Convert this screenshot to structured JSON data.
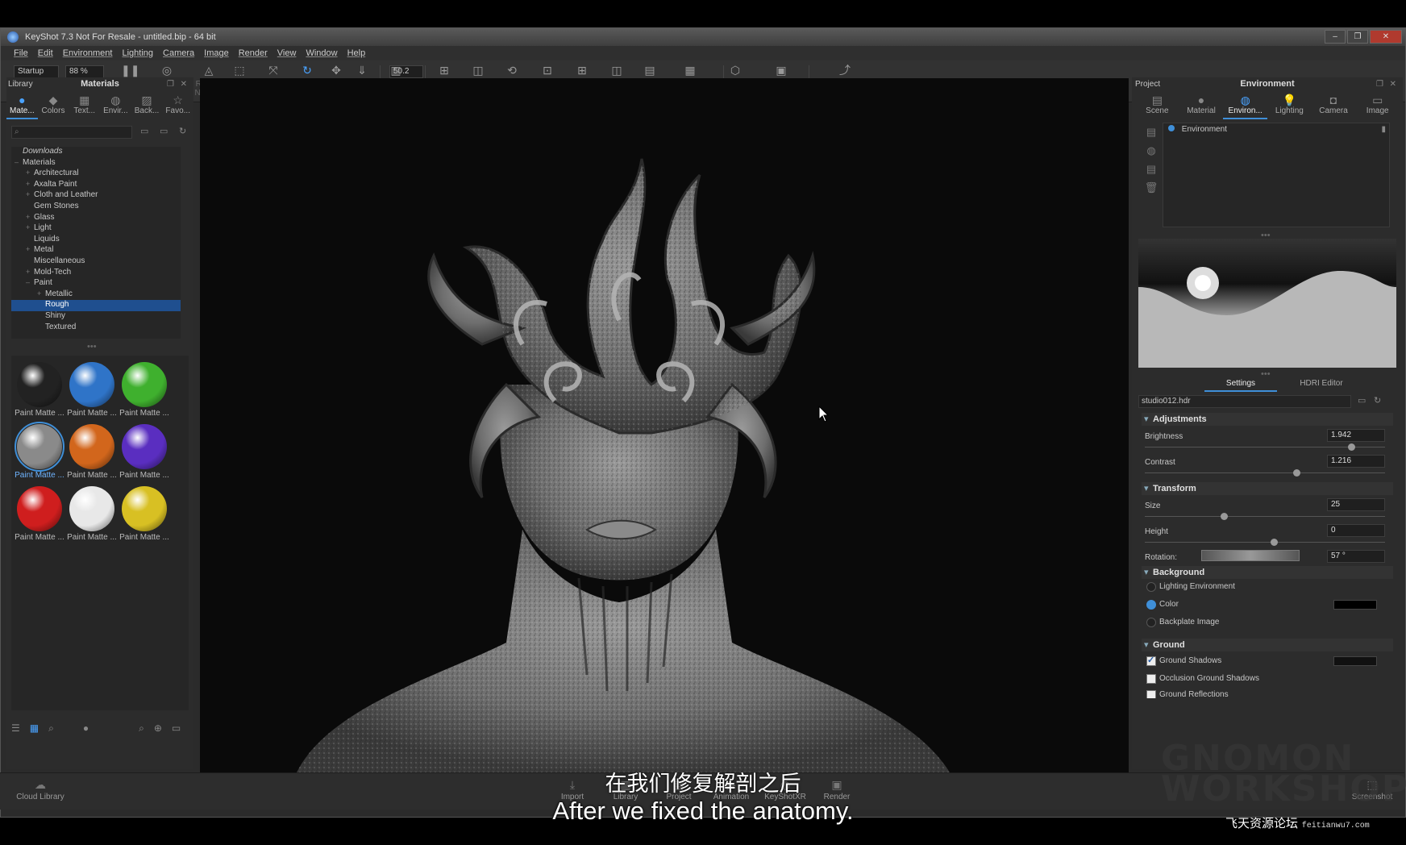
{
  "window": {
    "title": "KeyShot 7.3 Not For Resale - untitled.bip - 64 bit",
    "controls": [
      "–",
      "❐",
      "✕"
    ]
  },
  "menu": [
    "File",
    "Edit",
    "Environment",
    "Lighting",
    "Camera",
    "Image",
    "Render",
    "View",
    "Window",
    "Help"
  ],
  "toolbar": {
    "workspace_value": "Startup",
    "cpu_value": "88 %",
    "perspective_value": "50.2",
    "items": [
      {
        "label": "Workspaces",
        "icon": "workspaces-icon",
        "glyph": ""
      },
      {
        "label": "CPU Usage",
        "icon": "cpu-icon",
        "glyph": ""
      },
      {
        "label": "Pause",
        "icon": "pause-icon",
        "glyph": "❚❚"
      },
      {
        "label": "Performance Mode",
        "icon": "performance-icon",
        "glyph": "◎"
      },
      {
        "label": "Render NURBS",
        "icon": "nurbs-icon",
        "glyph": "◬"
      },
      {
        "label": "Region",
        "icon": "region-icon",
        "glyph": "⬚"
      },
      {
        "label": "Move Tool",
        "icon": "move-tool-icon",
        "glyph": "⤧"
      },
      {
        "label": "Tumble",
        "icon": "tumble-icon",
        "glyph": "↻"
      },
      {
        "label": "Pan",
        "icon": "pan-icon",
        "glyph": "✥"
      },
      {
        "label": "Dolly",
        "icon": "dolly-icon",
        "glyph": "⇓"
      },
      {
        "label": "Perspective",
        "icon": "perspective-icon",
        "glyph": "▥"
      },
      {
        "label": "Add Camera",
        "icon": "add-camera-icon",
        "glyph": "⊞"
      },
      {
        "label": "Cycle Cameras",
        "icon": "cycle-cameras-icon",
        "glyph": "◫"
      },
      {
        "label": "Reset Camera",
        "icon": "reset-camera-icon",
        "glyph": "⟲"
      },
      {
        "label": "Lock Camera",
        "icon": "lock-camera-icon",
        "glyph": "⊡"
      },
      {
        "label": "Add Studio",
        "icon": "add-studio-icon",
        "glyph": "⊞"
      },
      {
        "label": "Cycle Studios",
        "icon": "cycle-studios-icon",
        "glyph": "◫"
      },
      {
        "label": "Studios",
        "icon": "studios-icon",
        "glyph": "▤"
      },
      {
        "label": "Material Templates",
        "icon": "material-templates-icon",
        "glyph": "▦"
      },
      {
        "label": "Geometry View",
        "icon": "geometry-view-icon",
        "glyph": "⬡"
      },
      {
        "label": "Configurator Wizard",
        "icon": "configurator-wizard-icon",
        "glyph": "▣"
      },
      {
        "label": "Return to Link Application",
        "icon": "return-link-icon",
        "glyph": "⤴"
      }
    ]
  },
  "library": {
    "title": "Library",
    "panel_title": "Materials",
    "tabs": [
      {
        "label": "Mate...",
        "icon": "materials-tab-icon",
        "glyph": "●"
      },
      {
        "label": "Colors",
        "icon": "colors-tab-icon",
        "glyph": "◆"
      },
      {
        "label": "Text...",
        "icon": "textures-tab-icon",
        "glyph": "▦"
      },
      {
        "label": "Envir...",
        "icon": "environments-tab-icon",
        "glyph": "◍"
      },
      {
        "label": "Back...",
        "icon": "backplates-tab-icon",
        "glyph": "▨"
      },
      {
        "label": "Favo...",
        "icon": "favorites-tab-icon",
        "glyph": "☆"
      }
    ],
    "tree": [
      {
        "label": "Downloads",
        "indent": 0,
        "exp": ""
      },
      {
        "label": "Materials",
        "indent": 0,
        "exp": "–"
      },
      {
        "label": "Architectural",
        "indent": 1,
        "exp": "+"
      },
      {
        "label": "Axalta Paint",
        "indent": 1,
        "exp": "+"
      },
      {
        "label": "Cloth and Leather",
        "indent": 1,
        "exp": "+"
      },
      {
        "label": "Gem Stones",
        "indent": 1,
        "exp": ""
      },
      {
        "label": "Glass",
        "indent": 1,
        "exp": "+"
      },
      {
        "label": "Light",
        "indent": 1,
        "exp": "+"
      },
      {
        "label": "Liquids",
        "indent": 1,
        "exp": ""
      },
      {
        "label": "Metal",
        "indent": 1,
        "exp": "+"
      },
      {
        "label": "Miscellaneous",
        "indent": 1,
        "exp": ""
      },
      {
        "label": "Mold-Tech",
        "indent": 1,
        "exp": "+"
      },
      {
        "label": "Paint",
        "indent": 1,
        "exp": "–"
      },
      {
        "label": "Metallic",
        "indent": 2,
        "exp": "+"
      },
      {
        "label": "Rough",
        "indent": 2,
        "exp": "",
        "selected": true
      },
      {
        "label": "Shiny",
        "indent": 2,
        "exp": ""
      },
      {
        "label": "Textured",
        "indent": 2,
        "exp": ""
      }
    ],
    "swatches": [
      {
        "label": "Paint Matte ...",
        "color": "#222222"
      },
      {
        "label": "Paint Matte ...",
        "color": "#2f74c8"
      },
      {
        "label": "Paint Matte ...",
        "color": "#3fb02e"
      },
      {
        "label": "Paint Matte ...",
        "color": "#8a8a8a",
        "selected": true
      },
      {
        "label": "Paint Matte ...",
        "color": "#d2661c"
      },
      {
        "label": "Paint Matte ...",
        "color": "#5a2ec0"
      },
      {
        "label": "Paint Matte ...",
        "color": "#cf1e1e"
      },
      {
        "label": "Paint Matte ...",
        "color": "#e8e8e8"
      },
      {
        "label": "Paint Matte ...",
        "color": "#d8c023"
      }
    ]
  },
  "project": {
    "title": "Project",
    "panel_title": "Environment",
    "tabs": [
      {
        "label": "Scene",
        "icon": "scene-tab-icon",
        "glyph": "▤"
      },
      {
        "label": "Material",
        "icon": "material-tab-icon",
        "glyph": "●"
      },
      {
        "label": "Environ...",
        "icon": "environment-tab-icon",
        "glyph": "◍"
      },
      {
        "label": "Lighting",
        "icon": "lighting-tab-icon",
        "glyph": "💡"
      },
      {
        "label": "Camera",
        "icon": "camera-tab-icon",
        "glyph": "◘"
      },
      {
        "label": "Image",
        "icon": "image-tab-icon",
        "glyph": "▭"
      }
    ],
    "env_list_item": "Environment",
    "subtabs": [
      "Settings",
      "HDRI Editor"
    ],
    "hdr_file": "studio012.hdr",
    "adjustments_title": "Adjustments",
    "brightness_label": "Brightness",
    "brightness_value": "1.942",
    "contrast_label": "Contrast",
    "contrast_value": "1.216",
    "transform_title": "Transform",
    "size_label": "Size",
    "size_value": "25",
    "height_label": "Height",
    "height_value": "0",
    "rotation_label": "Rotation:",
    "rotation_value": "57 °",
    "background_title": "Background",
    "bg_options": [
      "Lighting Environment",
      "Color",
      "Backplate Image"
    ],
    "ground_title": "Ground",
    "ground_options": [
      "Ground Shadows",
      "Occlusion Ground Shadows",
      "Ground Reflections"
    ],
    "background_color": "#000000"
  },
  "bottom": {
    "cloud_library": "Cloud Library",
    "items": [
      "Import",
      "Library",
      "Project",
      "Animation",
      "KeyShotXR",
      "Render"
    ],
    "screenshot": "Screenshot"
  },
  "subtitles": {
    "cn": "在我们修复解剖之后",
    "en": "After we fixed the anatomy."
  },
  "watermark": {
    "cn": "飞天资源论坛",
    "url": "feitianwu7.com",
    "brand": "GNOMON\nWORKSHOP"
  },
  "colors": {
    "accent": "#3f8fd8",
    "selection": "#1f4f8f"
  }
}
